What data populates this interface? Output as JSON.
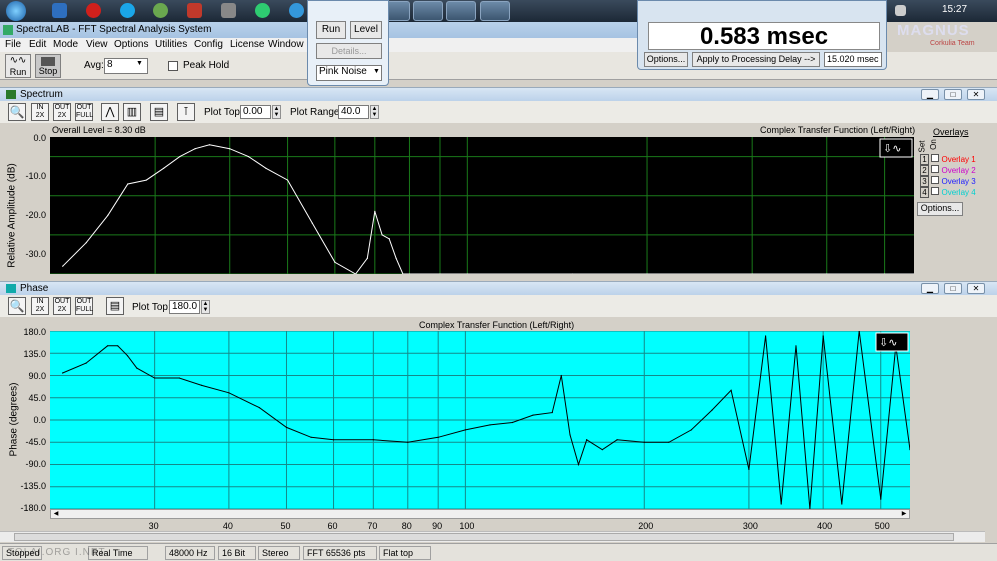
{
  "taskbar": {
    "lang": "EN",
    "clock": "15:27",
    "watermark": "MAGNUS",
    "watermark_sub": "Corkulia Team"
  },
  "window": {
    "title": "SpectraLAB - FFT Spectral Analysis System"
  },
  "menu": [
    "File",
    "Edit",
    "Mode",
    "View",
    "Options",
    "Utilities",
    "Config",
    "License",
    "Window"
  ],
  "toolbar": {
    "run_label": "Run",
    "stop_label": "Stop",
    "avg_label": "Avg:",
    "avg_value": "8",
    "peak_hold_label": "Peak Hold"
  },
  "runwin": {
    "run": "Run",
    "level": "Level",
    "details": "Details...",
    "noise": "Pink Noise"
  },
  "delaywin": {
    "value": "0.583 msec",
    "options": "Options...",
    "apply": "Apply to Processing Delay -->",
    "delay_value": "15.020 msec"
  },
  "spectrum": {
    "title": "Spectrum",
    "plot_top_label": "Plot Top:",
    "plot_top": "0.00",
    "plot_range_label": "Plot Range:",
    "plot_range": "40.0",
    "overall": "Overall Level = 8.30 dB",
    "chart_title": "Complex Transfer Function (Left/Right)",
    "ylabel": "Relative Amplitude (dB)",
    "yticks": [
      "0.0",
      "-10.0",
      "-20.0",
      "-30.0"
    ],
    "overlays": {
      "title": "Overlays",
      "set": "Set",
      "on": "On",
      "items": [
        {
          "n": "1",
          "label": "Overlay 1",
          "color": "#ff0000"
        },
        {
          "n": "2",
          "label": "Overlay 2",
          "color": "#cc00cc"
        },
        {
          "n": "3",
          "label": "Overlay 3",
          "color": "#2020ff"
        },
        {
          "n": "4",
          "label": "Overlay 4",
          "color": "#00d0d0"
        }
      ],
      "options": "Options..."
    }
  },
  "phase": {
    "title": "Phase",
    "plot_top_label": "Plot Top:",
    "plot_top": "180.0",
    "chart_title": "Complex Transfer Function (Left/Right)",
    "ylabel": "Phase (degrees)",
    "yticks": [
      "180.0",
      "135.0",
      "90.0",
      "45.0",
      "0.0",
      "-45.0",
      "-90.0",
      "-135.0",
      "-180.0"
    ],
    "xticks": [
      "30",
      "40",
      "50",
      "60",
      "70",
      "80",
      "90",
      "100",
      "200",
      "300",
      "400",
      "500"
    ]
  },
  "status": {
    "state": "Stopped",
    "mode": "Real Time",
    "rate": "48000 Hz",
    "bits": "16 Bit",
    "channels": "Stereo",
    "fft": "FFT 65536 pts",
    "window": "Flat top",
    "overlay_watermark": "TOLAI.ORG    I.NET"
  },
  "chart_data": [
    {
      "type": "line",
      "title": "Complex Transfer Function (Left/Right)",
      "xlabel": "",
      "ylabel": "Relative Amplitude (dB)",
      "xscale": "log",
      "ylim": [
        -35,
        0
      ],
      "background": "#000000",
      "line_color": "#ffffff",
      "x": [
        21,
        23,
        25,
        27,
        29,
        31,
        33,
        35,
        37,
        40,
        43,
        46,
        50,
        55,
        60,
        65,
        68,
        70,
        72,
        74,
        76,
        78,
        80,
        90,
        100,
        150,
        200,
        300,
        400,
        500,
        560
      ],
      "y": [
        -33,
        -27,
        -20,
        -12,
        -11,
        -8,
        -5,
        -3,
        -2,
        -3,
        -5,
        -8,
        -11,
        -22,
        -32,
        -35,
        -31,
        -19,
        -25,
        -26,
        -31,
        -35,
        -35,
        -35,
        -35,
        -35,
        -35,
        -35,
        -35,
        -35,
        -35
      ]
    },
    {
      "type": "line",
      "title": "Complex Transfer Function (Left/Right)",
      "xlabel": "",
      "ylabel": "Phase (degrees)",
      "xscale": "log",
      "ylim": [
        -180,
        180
      ],
      "background": "#00ffff",
      "line_color": "#000000",
      "x": [
        21,
        23,
        25,
        26,
        27,
        28,
        30,
        33,
        36,
        40,
        45,
        50,
        55,
        60,
        70,
        80,
        90,
        100,
        110,
        120,
        130,
        140,
        145,
        150,
        155,
        160,
        170,
        180,
        200,
        220,
        240,
        260,
        280,
        300,
        320,
        340,
        360,
        380,
        400,
        430,
        460,
        500,
        530,
        560
      ],
      "y": [
        95,
        115,
        150,
        150,
        130,
        105,
        85,
        85,
        70,
        55,
        25,
        -15,
        -35,
        -40,
        -40,
        -45,
        -35,
        -20,
        -10,
        -5,
        10,
        15,
        90,
        -30,
        -90,
        -40,
        -60,
        -40,
        -45,
        -45,
        -20,
        20,
        60,
        -100,
        170,
        -170,
        150,
        -180,
        170,
        -170,
        180,
        -160,
        150,
        -60
      ]
    }
  ]
}
